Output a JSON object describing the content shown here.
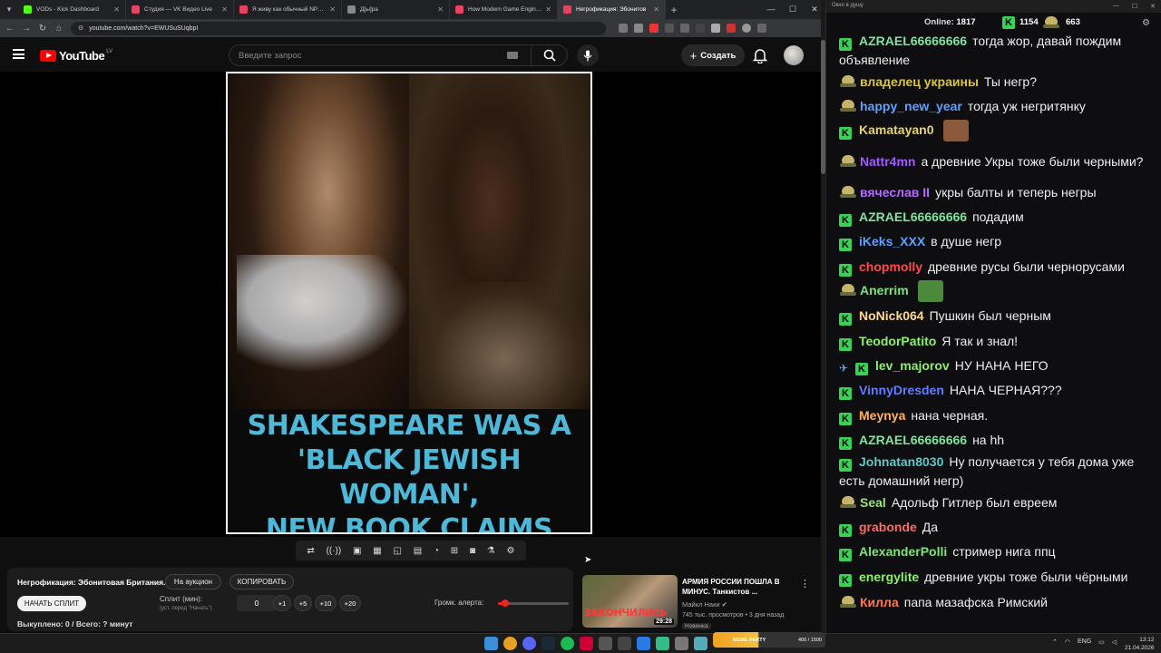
{
  "browser": {
    "tabs": [
      {
        "title": "VODs - Kick Dashboard",
        "color": "#53fc18"
      },
      {
        "title": "Студия — VK Видео Live",
        "color": "#e9415f"
      },
      {
        "title": "Я живу как обычный NPC в К",
        "color": "#e9415f"
      },
      {
        "title": "Д[ы]ра",
        "color": "#888888"
      },
      {
        "title": "How Modern Game Engines Dr",
        "color": "#e9415f"
      },
      {
        "title": "Негрофикация: Эбонитов",
        "color": "#e9415f",
        "active": true
      }
    ],
    "url": "youtube.com/watch?v=EWUSuSUqbpI"
  },
  "youtube": {
    "logo_text": "YouTube",
    "country_code": "LV",
    "search_placeholder": "Введите запрос",
    "create_label": "Создать"
  },
  "video": {
    "caption_lines": [
      "SHAKESPEARE WAS A",
      "'BLACK JEWISH WOMAN',",
      "NEW BOOK CLAIMS"
    ]
  },
  "panel": {
    "title": "Негрофикация: Эбонитовая Британия.",
    "auction_button": "На аукцион",
    "copy_button": "КОПИРОВАТЬ",
    "start_split_button": "НАЧАТЬ СПЛИТ",
    "split_label": "Сплит (мин):",
    "split_hint": "(уст. перед \"Начать\")",
    "split_value": "0",
    "steps": [
      "+1",
      "+5",
      "+10",
      "+20"
    ],
    "alert_volume_label": "Громк. алерта:",
    "alert_volume_fraction": 0.1,
    "status": "Выкуплено: 0 / Всего: ? минут"
  },
  "recommended": {
    "title": "АРМИЯ РОССИИ ПОШЛА В МИНУС. Танкистов ...",
    "channel": "Майкл Наки",
    "meta": "745 тыс. просмотров • 3 дня назад",
    "badge": "Новинка",
    "duration": "29:28",
    "thumb_text": "ЗАКОНЧИЛИСЬ"
  },
  "chat": {
    "window_title": "Окно в душу",
    "online_label": "Online:",
    "online_count": "1817",
    "kick_count": "1154",
    "other_count": "663",
    "messages": [
      {
        "badge": "k",
        "user": "AZRAEL66666666",
        "color": "#7ee3a0",
        "text": "тогда жор, давай пождим объявление",
        "tall": true
      },
      {
        "badge": "p",
        "user": "владелец украины",
        "color": "#d9c440",
        "text": "Ты негр?"
      },
      {
        "badge": "p",
        "user": "happy_new_year",
        "color": "#5fa0ff",
        "text": "тогда уж негритянку"
      },
      {
        "badge": "k",
        "user": "Kamatayan0",
        "color": "#e7d36a",
        "text": "",
        "emote": "#8a5a3a"
      },
      {
        "badge": "p",
        "user": "Nattr4mn",
        "color": "#a259ff",
        "text": "а древние Укры тоже были черными?",
        "tall": true
      },
      {
        "badge": "p",
        "user": "вячеслав II",
        "color": "#b46bff",
        "text": "укры балты и теперь негры"
      },
      {
        "badge": "k",
        "user": "AZRAEL66666666",
        "color": "#7ee3a0",
        "text": "подадим"
      },
      {
        "badge": "k",
        "user": "iKeks_XXX",
        "color": "#5fa0ff",
        "text": "в душе негр"
      },
      {
        "badge": "k",
        "user": "chopmolly",
        "color": "#ff4a4a",
        "text": "древние русы были чернорусами"
      },
      {
        "badge": "p",
        "user": "Anerrim",
        "color": "#7ee37a",
        "text": "",
        "emote": "#4a8a3a"
      },
      {
        "badge": "k",
        "user": "NoNick064",
        "color": "#ffd98a",
        "text": "Пушкин был черным"
      },
      {
        "badge": "k",
        "user": "TeodorPatito",
        "color": "#8ef06a",
        "text": "Я так и знал!"
      },
      {
        "badge": "vk",
        "user": "lev_majorov",
        "color": "#8ef06a",
        "text": "НУ НАНА НЕГО"
      },
      {
        "badge": "k",
        "user": "VinnyDresden",
        "color": "#5f7cff",
        "text": "НАНА ЧЕРНАЯ???"
      },
      {
        "badge": "k",
        "user": "Meynya",
        "color": "#ffb35f",
        "text": "нана черная."
      },
      {
        "badge": "k",
        "user": "AZRAEL66666666",
        "color": "#7ee3a0",
        "text": "на hh"
      },
      {
        "badge": "k",
        "user": "Johnatan8030",
        "color": "#5fc8c8",
        "text": "Ну получается у тебя дома уже есть домашний негр)",
        "tall": true
      },
      {
        "badge": "p",
        "user": "Seal",
        "color": "#9ee07a",
        "text": "Адольф Гитлер был евреем"
      },
      {
        "badge": "k",
        "user": "grabonde",
        "color": "#ff6a6a",
        "text": "Да"
      },
      {
        "badge": "k",
        "user": "AlexanderPolli",
        "color": "#7ee37a",
        "text": "стример нига ппц"
      },
      {
        "badge": "k",
        "user": "energylite",
        "color": "#8ef06a",
        "text": "древние укры тоже были чёрными"
      },
      {
        "badge": "p",
        "user": "Килла",
        "color": "#ff7a4a",
        "text": "папа мазафска Римский"
      }
    ]
  },
  "taskbar": {
    "widget_label": "MEME PARTY",
    "widget_value": "400 / 1500",
    "lang": "ENG",
    "time": "13:12",
    "date": "21.04.2026"
  }
}
